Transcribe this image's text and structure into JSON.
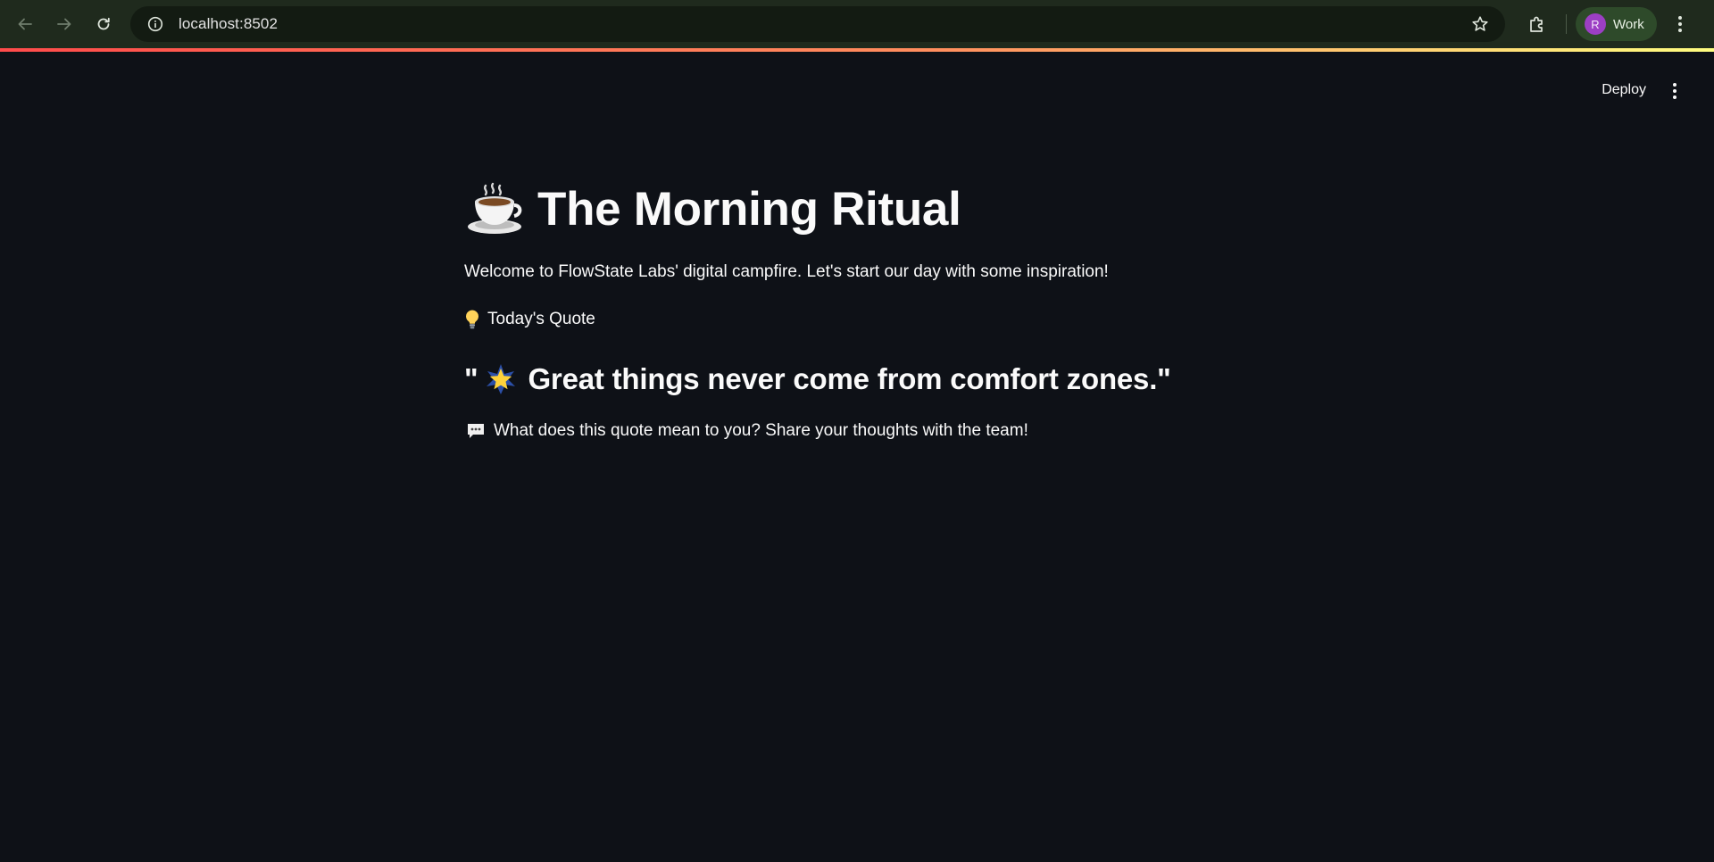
{
  "browser": {
    "url": "localhost:8502",
    "profile_initial": "R",
    "profile_label": "Work",
    "accent_colors": [
      "#ff4b4b",
      "#ff8f5e",
      "#fffd80"
    ],
    "icons": {
      "back": "arrow-left-icon",
      "forward": "arrow-right-icon",
      "reload": "reload-icon",
      "site_info": "info-icon",
      "bookmark": "star-outline-icon",
      "extensions": "puzzle-icon",
      "menu": "kebab-menu-icon"
    }
  },
  "app_header": {
    "deploy_label": "Deploy",
    "menu_icon": "kebab-menu-icon"
  },
  "main": {
    "title": "The Morning Ritual",
    "title_icon": "hot-beverage-emoji",
    "intro": "Welcome to FlowState Labs' digital campfire. Let's start our day with some inspiration!",
    "quote_label": "Today's Quote",
    "quote_label_icon": "light-bulb-emoji",
    "quote_open": "\"",
    "quote_icon": "glowing-star-emoji",
    "quote": "Great things never come from comfort zones.\"",
    "prompt": "What does this quote mean to you? Share your thoughts with the team!",
    "prompt_icon": "speech-balloon-emoji"
  }
}
